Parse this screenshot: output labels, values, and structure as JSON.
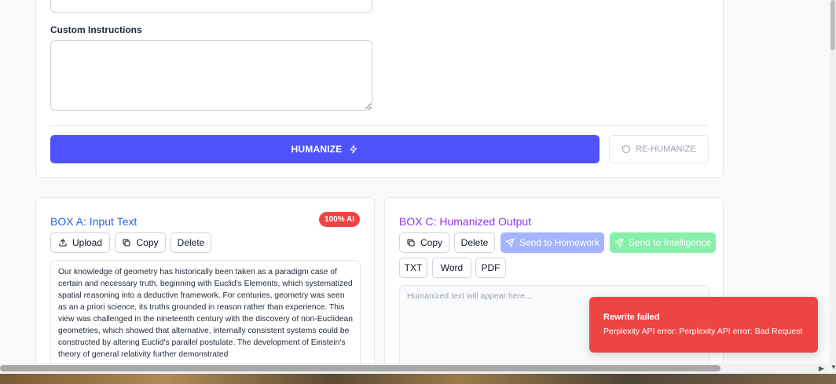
{
  "top_card": {
    "custom_instructions_label": "Custom Instructions",
    "custom_instructions_value": "",
    "humanize_label": "HUMANIZE",
    "rehumanize_label": "RE-HUMANIZE"
  },
  "box_a": {
    "title": "BOX A: Input Text",
    "badge": "100% AI",
    "buttons": {
      "upload": "Upload",
      "copy": "Copy",
      "delete": "Delete"
    },
    "text": "Our knowledge of geometry has historically been taken as a paradigm case of certain and necessary truth, beginning with Euclid's Elements, which systematized spatial reasoning into a deductive framework. For centuries, geometry was seen as an a priori science, its truths grounded in reason rather than experience. This view was challenged in the nineteenth century with the discovery of non-Euclidean geometries, which showed that alternative, internally consistent systems could be constructed by altering Euclid's parallel postulate. The development of Einstein's theory of general relativity further demonstrated"
  },
  "box_c": {
    "title": "BOX C: Humanized Output",
    "buttons": {
      "copy": "Copy",
      "delete": "Delete",
      "send_homework": "Send to Homework",
      "send_intelligence": "Send to Intelligence",
      "txt": "TXT",
      "word": "Word",
      "pdf": "PDF"
    },
    "output_placeholder": "Humanized text will appear here..."
  },
  "toast": {
    "title": "Rewrite failed",
    "message": "Perplexity API error: Perplexity API error: Bad Request"
  },
  "colors": {
    "primary": "#4f52fb",
    "box_a_title": "#2563eb",
    "box_c_title": "#9333ea",
    "error": "#ef4444",
    "send_homework": "#a5b4fc",
    "send_intelligence": "#86efac"
  }
}
